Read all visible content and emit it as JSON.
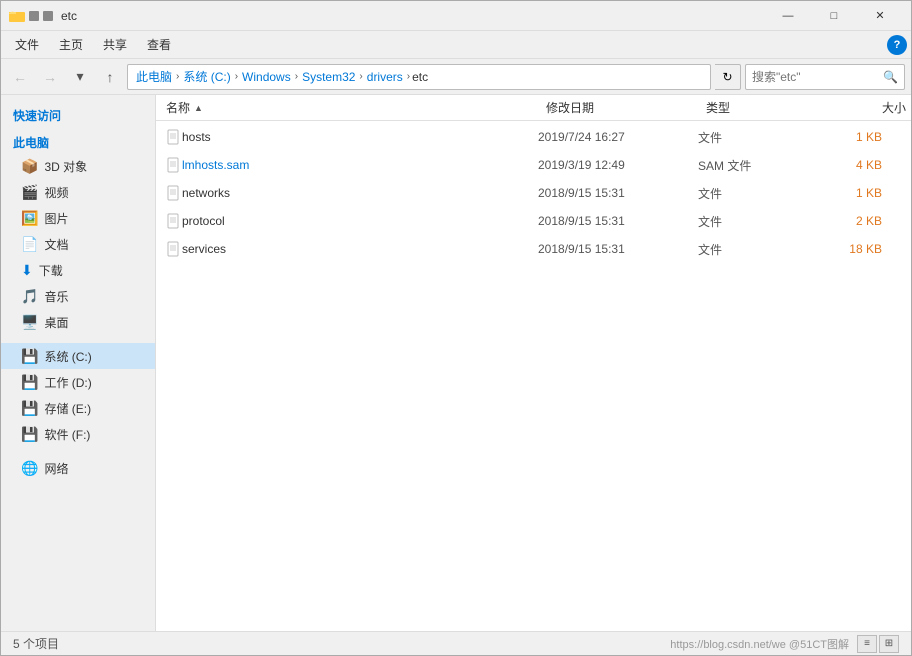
{
  "window": {
    "title": "etc",
    "title_bar_title": "etc"
  },
  "menu": {
    "items": [
      "文件",
      "主页",
      "共享",
      "查看"
    ]
  },
  "toolbar": {
    "back_title": "后退",
    "forward_title": "前进",
    "up_title": "上一级",
    "address": {
      "crumbs": [
        {
          "label": "此电脑",
          "sep": "›"
        },
        {
          "label": "系统 (C:)",
          "sep": "›"
        },
        {
          "label": "Windows",
          "sep": "›"
        },
        {
          "label": "System32",
          "sep": "›"
        },
        {
          "label": "drivers",
          "sep": "›"
        },
        {
          "label": "etc",
          "sep": ""
        }
      ]
    },
    "search_placeholder": "搜索\"etc\"",
    "refresh_title": "刷新"
  },
  "sidebar": {
    "quick_access_label": "快速访问",
    "this_pc_label": "此电脑",
    "items": [
      {
        "icon": "🎲",
        "label": "3D 对象"
      },
      {
        "icon": "🎬",
        "label": "视频"
      },
      {
        "icon": "🖼️",
        "label": "图片"
      },
      {
        "icon": "📄",
        "label": "文档"
      },
      {
        "icon": "⬇️",
        "label": "下载"
      },
      {
        "icon": "🎵",
        "label": "音乐"
      },
      {
        "icon": "🖥️",
        "label": "桌面"
      },
      {
        "icon": "💾",
        "label": "系统 (C:)",
        "active": true
      },
      {
        "icon": "💾",
        "label": "工作 (D:)"
      },
      {
        "icon": "💾",
        "label": "存储 (E:)"
      },
      {
        "icon": "💾",
        "label": "软件 (F:)"
      }
    ],
    "network_label": "网络"
  },
  "columns": {
    "name": "名称",
    "date": "修改日期",
    "type": "类型",
    "size": "大小"
  },
  "files": [
    {
      "name": "hosts",
      "date": "2019/7/24 16:27",
      "type": "文件",
      "size": "1 KB",
      "highlight": false
    },
    {
      "name": "lmhosts.sam",
      "date": "2019/3/19 12:49",
      "type": "SAM 文件",
      "size": "4 KB",
      "highlight": true
    },
    {
      "name": "networks",
      "date": "2018/9/15 15:31",
      "type": "文件",
      "size": "1 KB",
      "highlight": false
    },
    {
      "name": "protocol",
      "date": "2018/9/15 15:31",
      "type": "文件",
      "size": "2 KB",
      "highlight": false
    },
    {
      "name": "services",
      "date": "2018/9/15 15:31",
      "type": "文件",
      "size": "18 KB",
      "highlight": false
    }
  ],
  "status": {
    "item_count": "5 个项目",
    "watermark": "https://blog.csdn.net/we @51CT图解"
  },
  "colors": {
    "accent": "#0078d7",
    "highlight_size": "#e07820",
    "active_bg": "#cce4f7"
  }
}
